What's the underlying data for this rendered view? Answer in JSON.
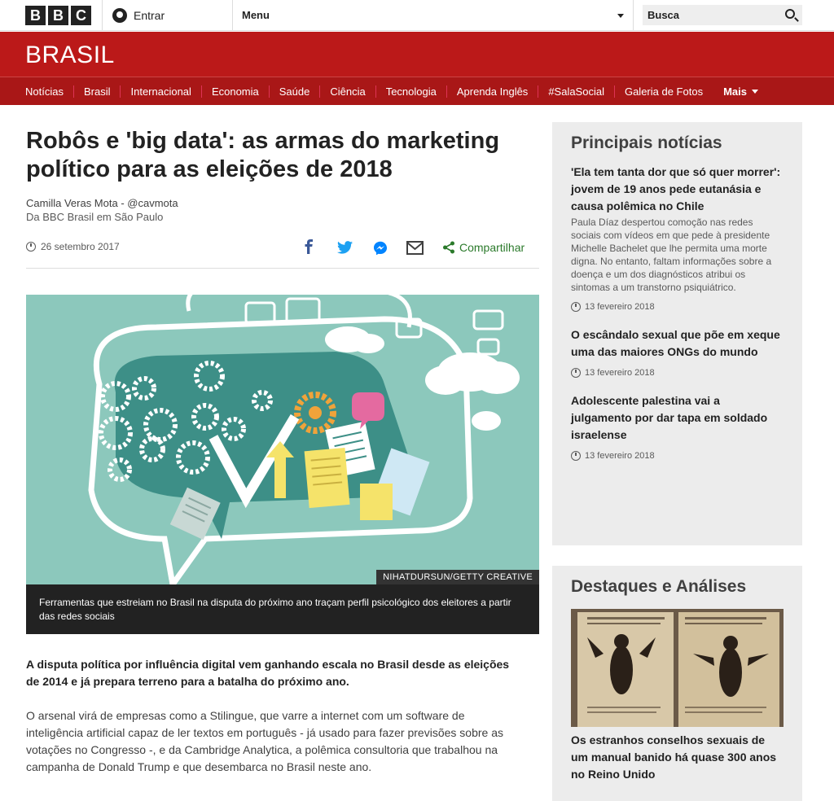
{
  "topbar": {
    "logo_letters": [
      "B",
      "B",
      "C"
    ],
    "signin_label": "Entrar",
    "menu_label": "Menu",
    "search_placeholder": "Busca"
  },
  "brand": {
    "title": "BRASIL",
    "color": "#bb1919"
  },
  "nav": {
    "items": [
      "Notícias",
      "Brasil",
      "Internacional",
      "Economia",
      "Saúde",
      "Ciência",
      "Tecnologia",
      "Aprenda Inglês",
      "#SalaSocial",
      "Galeria de Fotos"
    ],
    "more_label": "Mais"
  },
  "article": {
    "headline": "Robôs e 'big data': as armas do marketing político para as eleições de 2018",
    "author": "Camilla Veras Mota - @cavmota",
    "location": "Da BBC Brasil em São Paulo",
    "date": "26 setembro 2017",
    "share_label": "Compartilhar",
    "image_credit": "NIHATDURSUN/GETTY CREATIVE",
    "caption": "Ferramentas que estreiam no Brasil na disputa do próximo ano traçam perfil psicológico dos eleitores a partir das redes sociais",
    "lead": "A disputa política por influência digital vem ganhando escala no Brasil desde as eleições de 2014 e já prepara terreno para a batalha do próximo ano.",
    "body": "O arsenal virá de empresas como a Stilingue, que varre a internet com um software de inteligência artificial capaz de ler textos em português - já usado para fazer previsões sobre as votações no Congresso -, e da Cambridge Analytica, a polêmica consultoria que trabalhou na campanha de Donald Trump e que desembarca no Brasil neste ano."
  },
  "sidebar": {
    "top_title": "Principais notícias",
    "top_stories": [
      {
        "title": "'Ela tem tanta dor que só quer morrer': jovem de 19 anos pede eutanásia e causa polêmica no Chile",
        "summary": "Paula Díaz despertou comoção nas redes sociais com vídeos em que pede à presidente Michelle Bachelet que lhe permita uma morte digna. No entanto, faltam informações sobre a doença e um dos diagnósticos atribui os sintomas a um transtorno psiquiátrico.",
        "date": "13 fevereiro 2018"
      },
      {
        "title": "O escândalo sexual que põe em xeque uma das maiores ONGs do mundo",
        "date": "13 fevereiro 2018"
      },
      {
        "title": "Adolescente palestina vai a julgamento por dar tapa em soldado israelense",
        "date": "13 fevereiro 2018"
      }
    ],
    "features_title": "Destaques e Análises",
    "feature_story": {
      "title": "Os estranhos conselhos sexuais de um manual banido há quase 300 anos no Reino Unido"
    }
  }
}
